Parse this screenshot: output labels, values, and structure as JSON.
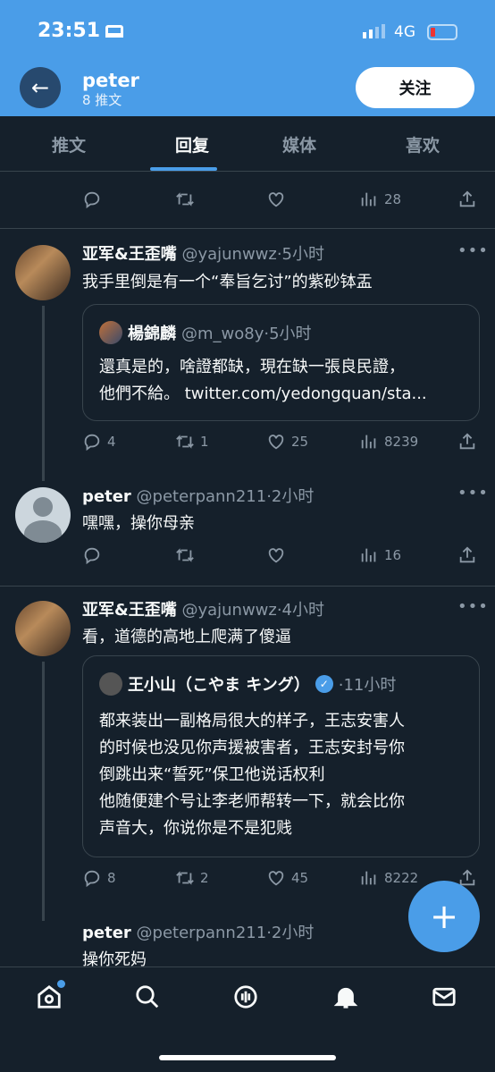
{
  "status": {
    "time": "23:51",
    "network": "4G"
  },
  "header": {
    "name": "peter",
    "count": "8 推文",
    "follow": "关注"
  },
  "tabs": [
    "推文",
    "回复",
    "媒体",
    "喜欢"
  ],
  "top_partial": {
    "views": "28"
  },
  "tweets": [
    {
      "name": "亚军&王歪嘴",
      "meta": "@yajunwwz·5小时",
      "text": "我手里倒是有一个“奉旨乞讨”的紫砂钵盂",
      "quote": {
        "name": "楊錦麟",
        "meta": "@m_wo8y·5小时",
        "lines": [
          "還真是的，啥證都缺，現在缺一張良民證，",
          "他們不給。 twitter.com/yedongquan/sta..."
        ]
      },
      "replies": "4",
      "retweets": "1",
      "likes": "25",
      "views": "8239"
    },
    {
      "name": "peter",
      "meta": "@peterpann211·2小时",
      "text": "嘿嘿，操你母亲",
      "views": "16"
    },
    {
      "name": "亚军&王歪嘴",
      "meta": "@yajunwwz·4小时",
      "text": "看，道德的高地上爬满了傻逼",
      "quote": {
        "name": "王小山（こやま キング）",
        "meta": "·11小时",
        "lines": [
          "都来装出一副格局很大的样子，王志安害人",
          "的时候也没见你声援被害者，王志安封号你",
          "倒跳出来“誓死”保卫他说话权利",
          "他随便建个号让李老师帮转一下，就会比你",
          "声音大，你说你是不是犯贱"
        ]
      },
      "replies": "8",
      "retweets": "2",
      "likes": "45",
      "views": "8222"
    },
    {
      "name": "peter",
      "meta": "@peterpann211·2小时",
      "text": "操你死妈"
    }
  ],
  "colors": {
    "accent": "#4a9de8",
    "bg": "#15202b"
  }
}
